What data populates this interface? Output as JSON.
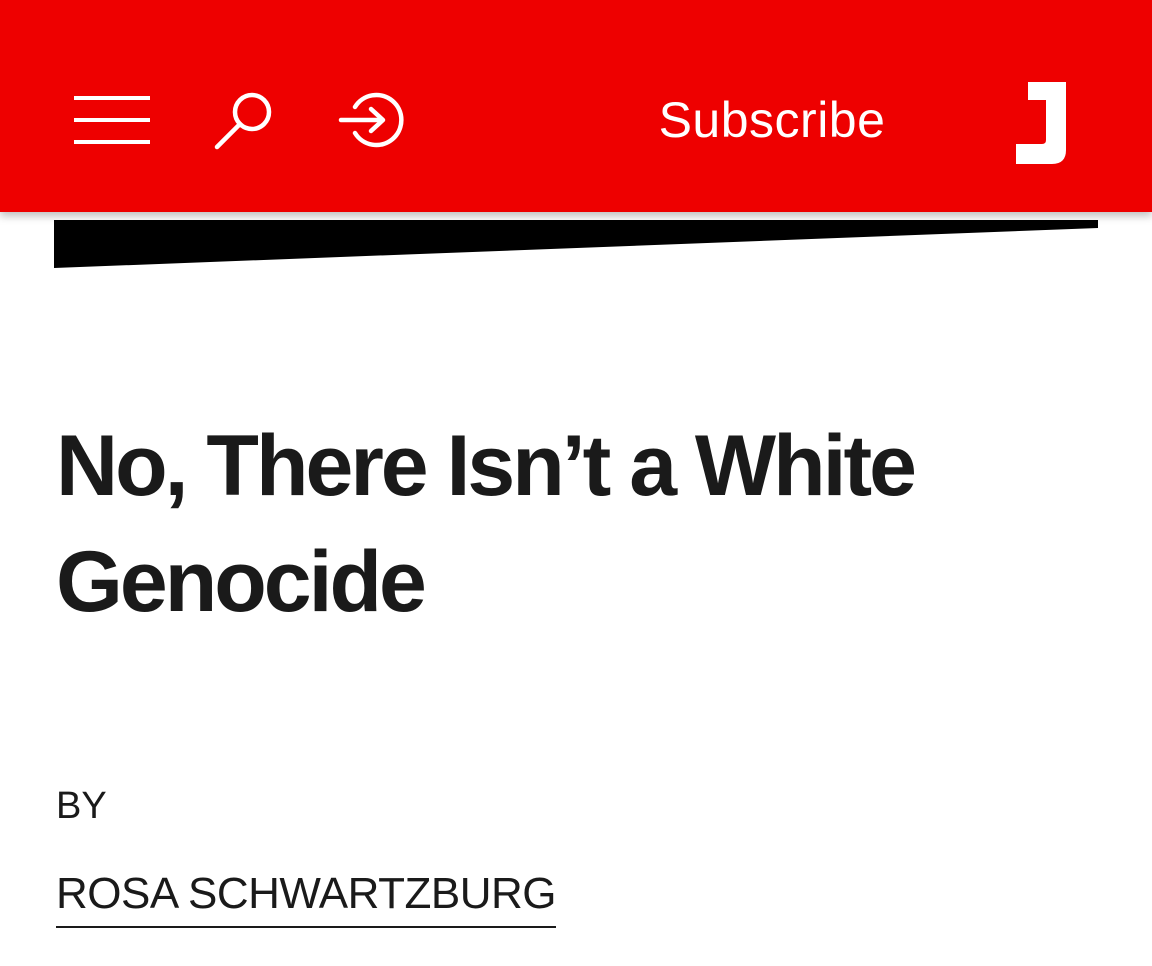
{
  "header": {
    "background": "#ee0000",
    "icons": {
      "menu": "hamburger-menu-icon",
      "search": "search-icon",
      "sign_in": "sign-in-icon"
    },
    "subscribe_label": "Subscribe",
    "logo_letter": "J"
  },
  "article": {
    "headline": "No, There Isn’t a White Genocide",
    "byline_label": "BY",
    "author": "ROSA SCHWARTZBURG"
  }
}
